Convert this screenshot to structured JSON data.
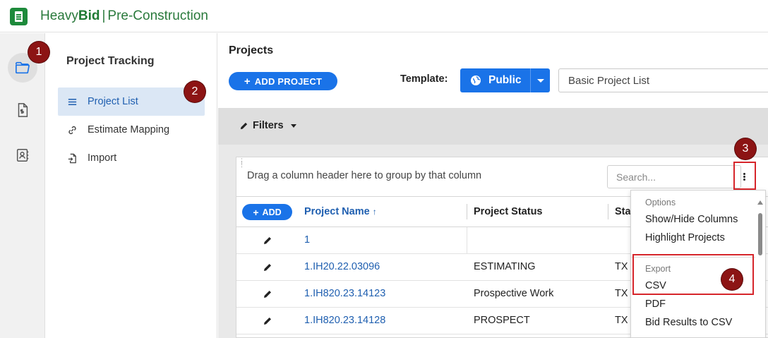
{
  "app": {
    "brand_light": "Heavy",
    "brand_bold": "Bid",
    "brand_separator": "|",
    "brand_sub": "Pre-Construction"
  },
  "rail": [
    {
      "name": "folder-icon",
      "active": true
    },
    {
      "name": "estimate-document-icon",
      "active": false
    },
    {
      "name": "contacts-icon",
      "active": false
    }
  ],
  "sidenav": {
    "title": "Project Tracking",
    "items": [
      {
        "label": "Project List",
        "icon": "list-icon",
        "active": true
      },
      {
        "label": "Estimate Mapping",
        "icon": "link-icon",
        "active": false
      },
      {
        "label": "Import",
        "icon": "import-icon",
        "active": false
      }
    ]
  },
  "main": {
    "title": "Projects",
    "add_project_label": "ADD PROJECT",
    "template_label": "Template:",
    "template_visibility": "Public",
    "template_value": "Basic Project List",
    "filters_label": "Filters"
  },
  "grid": {
    "group_hint": "Drag a column header here to group by that column",
    "search_placeholder": "Search...",
    "add_label": "ADD",
    "columns": [
      "Project Name",
      "Project Status",
      "Sta"
    ],
    "sort_indicator": "↑",
    "rows": [
      {
        "name": "1",
        "status": "",
        "state": ""
      },
      {
        "name": "1.IH20.22.03096",
        "status": "ESTIMATING",
        "state": "TX"
      },
      {
        "name": "1.IH820.23.14123",
        "status": "Prospective Work",
        "state": "TX"
      },
      {
        "name": "1.IH820.23.14128",
        "status": "PROSPECT",
        "state": "TX"
      }
    ]
  },
  "menu": {
    "options_header": "Options",
    "show_hide": "Show/Hide Columns",
    "highlight": "Highlight Projects",
    "export_header": "Export",
    "csv": "CSV",
    "pdf": "PDF",
    "bid_results": "Bid Results to CSV"
  },
  "callouts": [
    "1",
    "2",
    "3",
    "4"
  ],
  "colors": {
    "brand_green": "#1d8a3b",
    "accent_blue": "#1a73e8",
    "link_blue": "#1f5fb0",
    "callout_red": "#d6252b",
    "badge_maroon": "#8c1414"
  }
}
